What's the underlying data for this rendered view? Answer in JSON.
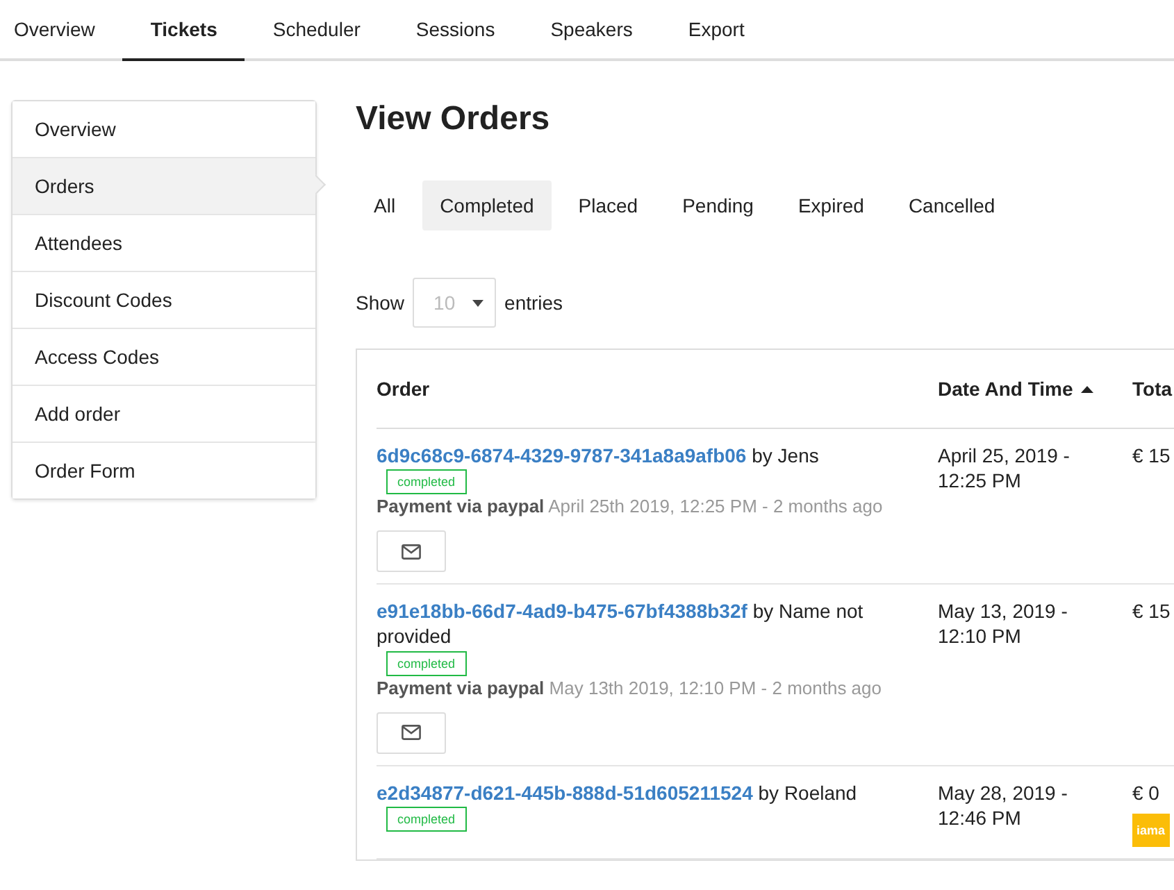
{
  "top_tabs": [
    {
      "label": "Overview",
      "selected": false
    },
    {
      "label": "Tickets",
      "selected": true
    },
    {
      "label": "Scheduler",
      "selected": false
    },
    {
      "label": "Sessions",
      "selected": false
    },
    {
      "label": "Speakers",
      "selected": false
    },
    {
      "label": "Export",
      "selected": false
    }
  ],
  "sidebar": {
    "items": [
      {
        "label": "Overview",
        "selected": false
      },
      {
        "label": "Orders",
        "selected": true
      },
      {
        "label": "Attendees",
        "selected": false
      },
      {
        "label": "Discount Codes",
        "selected": false
      },
      {
        "label": "Access Codes",
        "selected": false
      },
      {
        "label": "Add order",
        "selected": false
      },
      {
        "label": "Order Form",
        "selected": false
      }
    ]
  },
  "title": "View Orders",
  "filters": [
    {
      "label": "All",
      "selected": false
    },
    {
      "label": "Completed",
      "selected": true
    },
    {
      "label": "Placed",
      "selected": false
    },
    {
      "label": "Pending",
      "selected": false
    },
    {
      "label": "Expired",
      "selected": false
    },
    {
      "label": "Cancelled",
      "selected": false
    }
  ],
  "page_size": {
    "before": "Show",
    "value": "10",
    "after": "entries"
  },
  "table": {
    "columns": [
      {
        "label": "Order",
        "sorted": false
      },
      {
        "label": "Date And Time",
        "sorted": true
      },
      {
        "label": "Tota",
        "sorted": false
      }
    ],
    "rows": [
      {
        "order_id": "6d9c68c9-6874-4329-9787-341a8a9afb06",
        "by": "by Jens",
        "status": "completed",
        "payment_method": "Payment via paypal",
        "payment_time": "April 25th 2019, 12:25 PM - 2 months ago",
        "mail_button": true,
        "date": "April 25, 2019 - 12:25 PM",
        "total": "€ 15"
      },
      {
        "order_id": "e91e18bb-66d7-4ad9-b475-67bf4388b32f",
        "by": "by Name not provided",
        "status": "completed",
        "payment_method": "Payment via paypal",
        "payment_time": "May 13th 2019, 12:10 PM - 2 months ago",
        "mail_button": true,
        "date": "May 13, 2019 - 12:10 PM",
        "total": "€ 15"
      },
      {
        "order_id": "e2d34877-d621-445b-888d-51d605211524",
        "by": "by Roeland",
        "status": "completed",
        "mail_button": false,
        "date": "May 28, 2019 - 12:46 PM",
        "total": "€ 0",
        "tag": "iama"
      }
    ]
  }
}
